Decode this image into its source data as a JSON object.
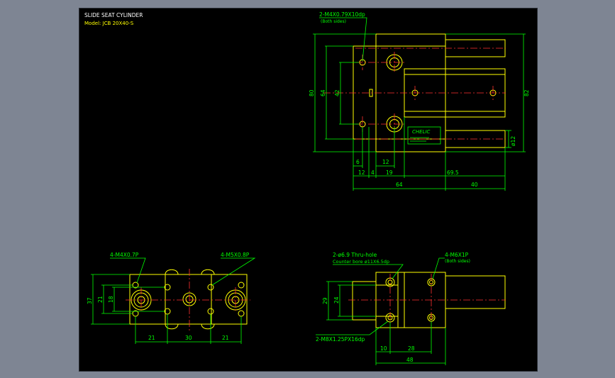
{
  "drawing": {
    "title": "SLIDE SEAT CYLINDER",
    "model": "Model: JCB 20X40-S"
  },
  "colors": {
    "background": "#000000",
    "frame": "#7e8593",
    "outline": "#ffff00",
    "dimension": "#00ff00",
    "centerline": "#ff3030",
    "note": "#ff00ff",
    "title": "#ffffff"
  },
  "top_view": {
    "note_line1": "2-M4X0.79X10dp",
    "note_line2": "(Both sides)",
    "brand": "CHELIC",
    "dims": {
      "h80": "80",
      "h64": "64",
      "h42": "42",
      "h82": "82",
      "dia12": "ø12",
      "d6": "6",
      "d12a": "12",
      "d12b": "12",
      "d4": "4",
      "d19": "19",
      "d69_5": "69.5",
      "d64": "64",
      "d40": "40"
    }
  },
  "bottom_left": {
    "note_left": "4-M4X0.7P",
    "note_right": "4-M5X0.8P",
    "dims": {
      "h37": "37",
      "h21": "21",
      "h18": "18",
      "d21a": "21",
      "d30": "30",
      "d21b": "21"
    }
  },
  "bottom_right": {
    "note_left_1": "2-ø6.9 Thru-hole",
    "note_left_2": "Counter bore ø11X6.5dp",
    "note_right_1": "4-M6X1P",
    "note_right_2": "(Both sides)",
    "note_bottom": "2-M8X1.25PX16dp",
    "dims": {
      "h29": "29",
      "h24": "24",
      "d10": "10",
      "d28": "28",
      "d48": "48"
    }
  }
}
